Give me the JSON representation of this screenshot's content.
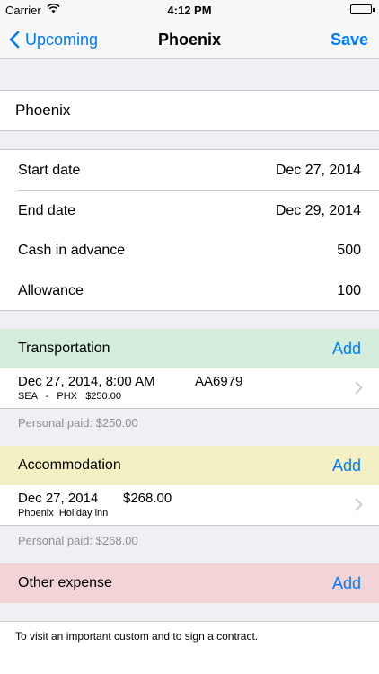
{
  "status_bar": {
    "carrier": "Carrier",
    "time": "4:12 PM"
  },
  "nav": {
    "back_label": "Upcoming",
    "title": "Phoenix",
    "save_label": "Save"
  },
  "trip": {
    "name": "Phoenix"
  },
  "details": [
    {
      "label": "Start date",
      "value": "Dec 27, 2014"
    },
    {
      "label": "End date",
      "value": "Dec 29, 2014"
    },
    {
      "label": "Cash in advance",
      "value": "500"
    },
    {
      "label": "Allowance",
      "value": "100"
    }
  ],
  "transportation": {
    "header": "Transportation",
    "add_label": "Add",
    "color": "#d4eedb",
    "item": {
      "datetime": "Dec 27, 2014, 8:00 AM",
      "flight": "AA6979",
      "route": "SEA   -   PHX   $250.00"
    },
    "personal_paid": "Personal paid: $250.00"
  },
  "accommodation": {
    "header": "Accommodation",
    "add_label": "Add",
    "color": "#f3f1c4",
    "item": {
      "date": "Dec 27, 2014",
      "amount": "$268.00",
      "place": "Phoenix  Holiday inn"
    },
    "personal_paid": "Personal paid: $268.00"
  },
  "other_expense": {
    "header": "Other expense",
    "add_label": "Add",
    "color": "#f2d3d6"
  },
  "note": "To visit an important custom and to sign a contract.",
  "colors": {
    "accent": "#007aff",
    "separator": "#c8c7cc",
    "background": "#efeff4"
  }
}
